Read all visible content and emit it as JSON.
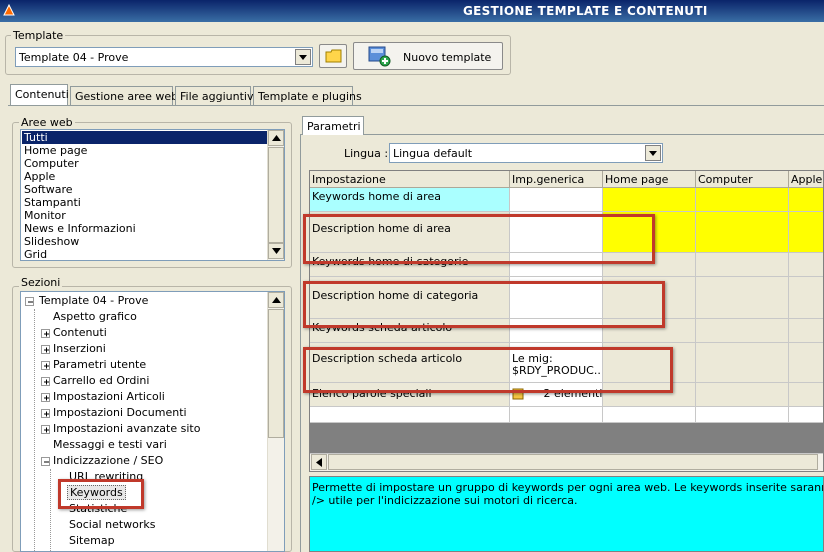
{
  "window": {
    "title": "GESTIONE TEMPLATE E CONTENUTI"
  },
  "template_group": {
    "legend": "Template",
    "selected": "Template 04 - Prove",
    "new_button": "Nuovo template"
  },
  "tabs": [
    "Contenuti",
    "Gestione aree web",
    "File aggiuntivi",
    "Template e plugins"
  ],
  "aree_web": {
    "legend": "Aree web",
    "items": [
      "Tutti",
      "Home page",
      "Computer",
      "Apple",
      "Software",
      "Stampanti",
      "Monitor",
      "News e Informazioni",
      "Slideshow",
      "Grid"
    ]
  },
  "sezioni": {
    "legend": "Sezioni",
    "root": "Template 04 - Prove",
    "items": [
      "Aspetto grafico",
      "Contenuti",
      "Inserzioni",
      "Parametri utente",
      "Carrello ed Ordini",
      "Impostazioni Articoli",
      "Impostazioni Documenti",
      "Impostazioni avanzate sito",
      "Messaggi e testi vari",
      "Indicizzazione / SEO",
      "URL rewriting",
      "Keywords",
      "Statistiche",
      "Social networks",
      "Sitemap"
    ]
  },
  "parametri": {
    "tab": "Parametri",
    "lingua_label": "Lingua :",
    "lingua_value": "Lingua default",
    "columns": [
      "Impostazione",
      "Imp.generica",
      "Home page",
      "Computer",
      "Apple"
    ],
    "rows": [
      {
        "name": "Keywords home di area",
        "generic": ""
      },
      {
        "name": "Description home di area",
        "generic": ""
      },
      {
        "name": "Keywords home di categorie",
        "generic": ""
      },
      {
        "name": "Description home di categoria",
        "generic": ""
      },
      {
        "name": "Keywords scheda articolo",
        "generic": ""
      },
      {
        "name": "Description scheda articolo",
        "generic": "Le mig:",
        "generic2": "$RDY_PRODUC..."
      },
      {
        "name": "Elenco parole speciali",
        "generic": "2 elementi"
      }
    ],
    "info": "Permette di impostare un gruppo di keywords per ogni area web. Le keywords inserite saranno utilizzate ne",
    "info2": "/> utile per l'indicizzazione sui motori di ricerca."
  },
  "colors": {
    "keywords_row": "#aaffff",
    "highlight": "#ffff00",
    "info_bg": "#00ffff",
    "annotation": "#c0392b"
  }
}
